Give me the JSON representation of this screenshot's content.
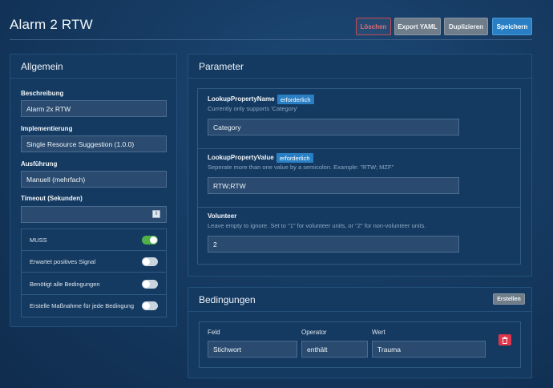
{
  "page": {
    "title": "Alarm 2 RTW"
  },
  "toolbar": {
    "delete_label": "Löschen",
    "export_label": "Export YAML",
    "duplicate_label": "Duplizieren",
    "save_label": "Speichern"
  },
  "general": {
    "title": "Allgemein",
    "description": {
      "label": "Beschreibung",
      "value": "Alarm 2x RTW"
    },
    "implementation": {
      "label": "Implementierung",
      "value": "Single Resource Suggestion (1.0.0)"
    },
    "execution": {
      "label": "Ausführung",
      "value": "Manuell (mehrfach)"
    },
    "timeout": {
      "label": "Timeout (Sekunden)",
      "value": ""
    },
    "toggles": [
      {
        "label": "MUSS",
        "on": true
      },
      {
        "label": "Erwartet positives Signal",
        "on": false
      },
      {
        "label": "Benötigt alle Bedingungen",
        "on": false
      },
      {
        "label": "Erstelle Maßnahme für jede Bedingung",
        "on": false
      }
    ]
  },
  "parameters": {
    "title": "Parameter",
    "items": [
      {
        "name": "LookupPropertyName",
        "badge": "erforderlich",
        "help": "Currently only supports 'Category'",
        "value": "Category"
      },
      {
        "name": "LookupPropertyValue",
        "badge": "erforderlich",
        "help": "Seperate more than one value by a semicolon. Example: \"RTW; MZF\"",
        "value": "RTW;RTW"
      },
      {
        "name": "Volunteer",
        "badge": "",
        "help": "Leave empty to ignore. Set to \"1\" for volunteer units, or \"2\" for non-volunteer units.",
        "value": "2"
      }
    ]
  },
  "conditions": {
    "title": "Bedingungen",
    "create_label": "Erstellen",
    "headers": {
      "field": "Feld",
      "operator": "Operator",
      "value": "Wert"
    },
    "rows": [
      {
        "field": "Stichwort",
        "operator": "enthält",
        "value": "Trauma"
      }
    ]
  },
  "colors": {
    "accent": "#2a7fc4",
    "danger": "#e0344a",
    "toggle_on": "#52b04a"
  }
}
